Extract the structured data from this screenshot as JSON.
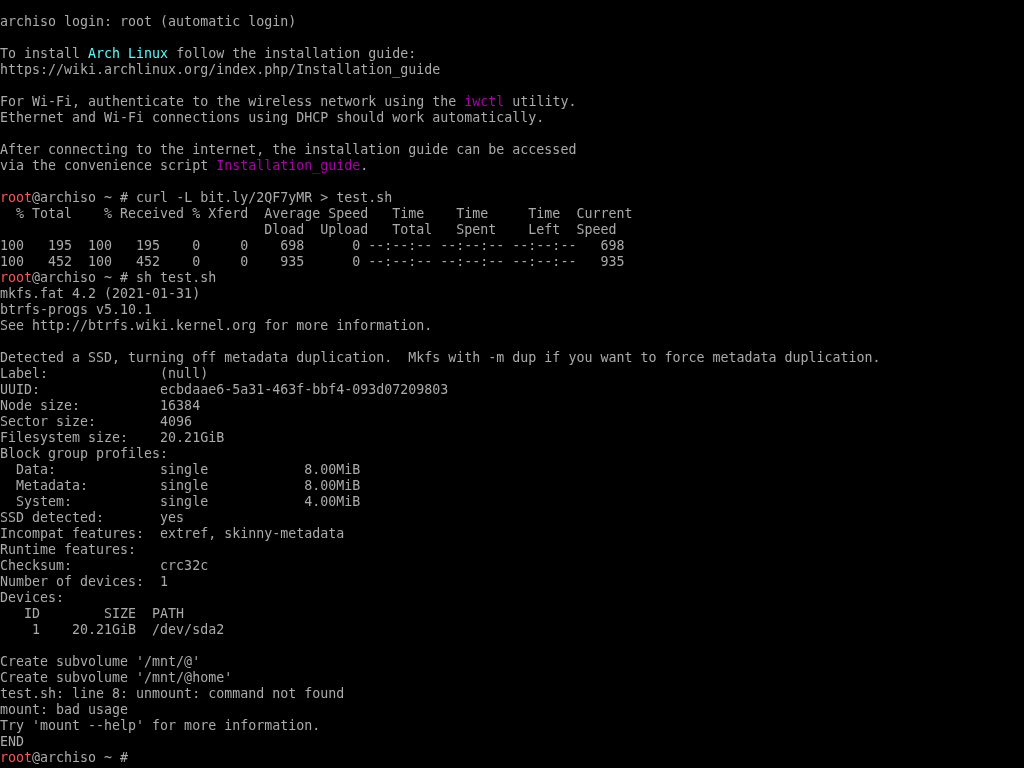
{
  "terminal": {
    "lines": [
      {
        "kind": "text",
        "segments": [
          {
            "text": "archiso login: root (automatic login)",
            "color": "#aaaaaa"
          }
        ]
      },
      {
        "kind": "blank"
      },
      {
        "kind": "text",
        "segments": [
          {
            "text": "To install ",
            "color": "#aaaaaa"
          },
          {
            "text": "Arch Linux",
            "color": "#55ffff"
          },
          {
            "text": " follow the installation guide:",
            "color": "#aaaaaa"
          }
        ]
      },
      {
        "kind": "text",
        "segments": [
          {
            "text": "https://wiki.archlinux.org/index.php/Installation_guide",
            "color": "#aaaaaa"
          }
        ]
      },
      {
        "kind": "blank"
      },
      {
        "kind": "text",
        "segments": [
          {
            "text": "For Wi-Fi, authenticate to the wireless network using the ",
            "color": "#aaaaaa"
          },
          {
            "text": "iwctl",
            "color": "#aa00aa"
          },
          {
            "text": " utility.",
            "color": "#aaaaaa"
          }
        ]
      },
      {
        "kind": "text",
        "segments": [
          {
            "text": "Ethernet and Wi-Fi connections using DHCP should work automatically.",
            "color": "#aaaaaa"
          }
        ]
      },
      {
        "kind": "blank"
      },
      {
        "kind": "text",
        "segments": [
          {
            "text": "After connecting to the internet, the installation guide can be accessed",
            "color": "#aaaaaa"
          }
        ]
      },
      {
        "kind": "text",
        "segments": [
          {
            "text": "via the convenience script ",
            "color": "#aaaaaa"
          },
          {
            "text": "Installation_guide",
            "color": "#aa00aa"
          },
          {
            "text": "."
          }
        ]
      },
      {
        "kind": "blank"
      },
      {
        "kind": "text",
        "segments": [
          {
            "text": "root",
            "color": "#ff5555"
          },
          {
            "text": "@archiso ~ # curl -L bit.ly/2QF7yMR > test.sh",
            "color": "#aaaaaa"
          }
        ]
      },
      {
        "kind": "text",
        "segments": [
          {
            "text": "  % Total    % Received % Xferd  Average Speed   Time    Time     Time  Current",
            "color": "#aaaaaa"
          }
        ]
      },
      {
        "kind": "text",
        "segments": [
          {
            "text": "                                 Dload  Upload   Total   Spent    Left  Speed",
            "color": "#aaaaaa"
          }
        ]
      },
      {
        "kind": "text",
        "segments": [
          {
            "text": "100   195  100   195    0     0    698      0 --:--:-- --:--:-- --:--:--   698",
            "color": "#aaaaaa"
          }
        ]
      },
      {
        "kind": "text",
        "segments": [
          {
            "text": "100   452  100   452    0     0    935      0 --:--:-- --:--:-- --:--:--   935",
            "color": "#aaaaaa"
          }
        ]
      },
      {
        "kind": "text",
        "segments": [
          {
            "text": "root",
            "color": "#ff5555"
          },
          {
            "text": "@archiso ~ # sh test.sh",
            "color": "#aaaaaa"
          }
        ]
      },
      {
        "kind": "text",
        "segments": [
          {
            "text": "mkfs.fat 4.2 (2021-01-31)",
            "color": "#aaaaaa"
          }
        ]
      },
      {
        "kind": "text",
        "segments": [
          {
            "text": "btrfs-progs v5.10.1",
            "color": "#aaaaaa"
          }
        ]
      },
      {
        "kind": "text",
        "segments": [
          {
            "text": "See http://btrfs.wiki.kernel.org for more information.",
            "color": "#aaaaaa"
          }
        ]
      },
      {
        "kind": "blank"
      },
      {
        "kind": "text",
        "segments": [
          {
            "text": "Detected a SSD, turning off metadata duplication.  Mkfs with -m dup if you want to force metadata duplication.",
            "color": "#aaaaaa"
          }
        ]
      },
      {
        "kind": "text",
        "segments": [
          {
            "text": "Label:              (null)",
            "color": "#aaaaaa"
          }
        ]
      },
      {
        "kind": "text",
        "segments": [
          {
            "text": "UUID:               ecbdaae6-5a31-463f-bbf4-093d07209803",
            "color": "#aaaaaa"
          }
        ]
      },
      {
        "kind": "text",
        "segments": [
          {
            "text": "Node size:          16384",
            "color": "#aaaaaa"
          }
        ]
      },
      {
        "kind": "text",
        "segments": [
          {
            "text": "Sector size:        4096",
            "color": "#aaaaaa"
          }
        ]
      },
      {
        "kind": "text",
        "segments": [
          {
            "text": "Filesystem size:    20.21GiB",
            "color": "#aaaaaa"
          }
        ]
      },
      {
        "kind": "text",
        "segments": [
          {
            "text": "Block group profiles:",
            "color": "#aaaaaa"
          }
        ]
      },
      {
        "kind": "text",
        "segments": [
          {
            "text": "  Data:             single            8.00MiB",
            "color": "#aaaaaa"
          }
        ]
      },
      {
        "kind": "text",
        "segments": [
          {
            "text": "  Metadata:         single            8.00MiB",
            "color": "#aaaaaa"
          }
        ]
      },
      {
        "kind": "text",
        "segments": [
          {
            "text": "  System:           single            4.00MiB",
            "color": "#aaaaaa"
          }
        ]
      },
      {
        "kind": "text",
        "segments": [
          {
            "text": "SSD detected:       yes",
            "color": "#aaaaaa"
          }
        ]
      },
      {
        "kind": "text",
        "segments": [
          {
            "text": "Incompat features:  extref, skinny-metadata",
            "color": "#aaaaaa"
          }
        ]
      },
      {
        "kind": "text",
        "segments": [
          {
            "text": "Runtime features:",
            "color": "#aaaaaa"
          }
        ]
      },
      {
        "kind": "text",
        "segments": [
          {
            "text": "Checksum:           crc32c",
            "color": "#aaaaaa"
          }
        ]
      },
      {
        "kind": "text",
        "segments": [
          {
            "text": "Number of devices:  1",
            "color": "#aaaaaa"
          }
        ]
      },
      {
        "kind": "text",
        "segments": [
          {
            "text": "Devices:",
            "color": "#aaaaaa"
          }
        ]
      },
      {
        "kind": "text",
        "segments": [
          {
            "text": "   ID        SIZE  PATH",
            "color": "#aaaaaa"
          }
        ]
      },
      {
        "kind": "text",
        "segments": [
          {
            "text": "    1    20.21GiB  /dev/sda2",
            "color": "#aaaaaa"
          }
        ]
      },
      {
        "kind": "blank"
      },
      {
        "kind": "text",
        "segments": [
          {
            "text": "Create subvolume '/mnt/@'",
            "color": "#aaaaaa"
          }
        ]
      },
      {
        "kind": "text",
        "segments": [
          {
            "text": "Create subvolume '/mnt/@home'",
            "color": "#aaaaaa"
          }
        ]
      },
      {
        "kind": "text",
        "segments": [
          {
            "text": "test.sh: line 8: unmount: command not found",
            "color": "#aaaaaa"
          }
        ]
      },
      {
        "kind": "text",
        "segments": [
          {
            "text": "mount: bad usage",
            "color": "#aaaaaa"
          }
        ]
      },
      {
        "kind": "text",
        "segments": [
          {
            "text": "Try 'mount --help' for more information.",
            "color": "#aaaaaa"
          }
        ]
      },
      {
        "kind": "text",
        "segments": [
          {
            "text": "END",
            "color": "#aaaaaa"
          }
        ]
      },
      {
        "kind": "text",
        "segments": [
          {
            "text": "root",
            "color": "#ff5555"
          },
          {
            "text": "@archiso ~ #",
            "color": "#aaaaaa"
          }
        ]
      }
    ]
  }
}
